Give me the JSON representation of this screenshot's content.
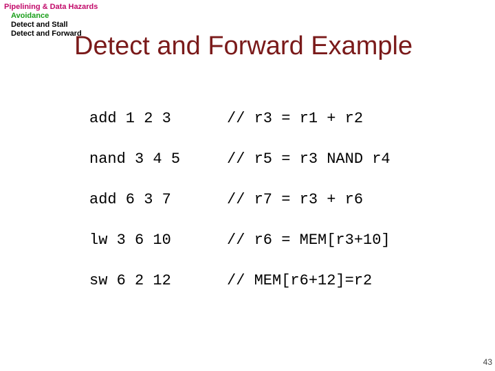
{
  "breadcrumb": {
    "top": "Pipelining & Data Hazards",
    "avoidance": "Avoidance",
    "stall": "Detect and Stall",
    "forward": "Detect and Forward"
  },
  "title": "Detect and Forward Example",
  "code": [
    {
      "op": "add 1 2 3",
      "comment": "// r3 = r1 + r2"
    },
    {
      "op": "nand 3 4 5",
      "comment": "// r5 = r3 NAND r4"
    },
    {
      "op": "add 6 3 7",
      "comment": "// r7 = r3 + r6"
    },
    {
      "op": "lw 3 6 10",
      "comment": "// r6 = MEM[r3+10]"
    },
    {
      "op": "sw 6 2 12",
      "comment": "// MEM[r6+12]=r2"
    }
  ],
  "page_number": "43"
}
